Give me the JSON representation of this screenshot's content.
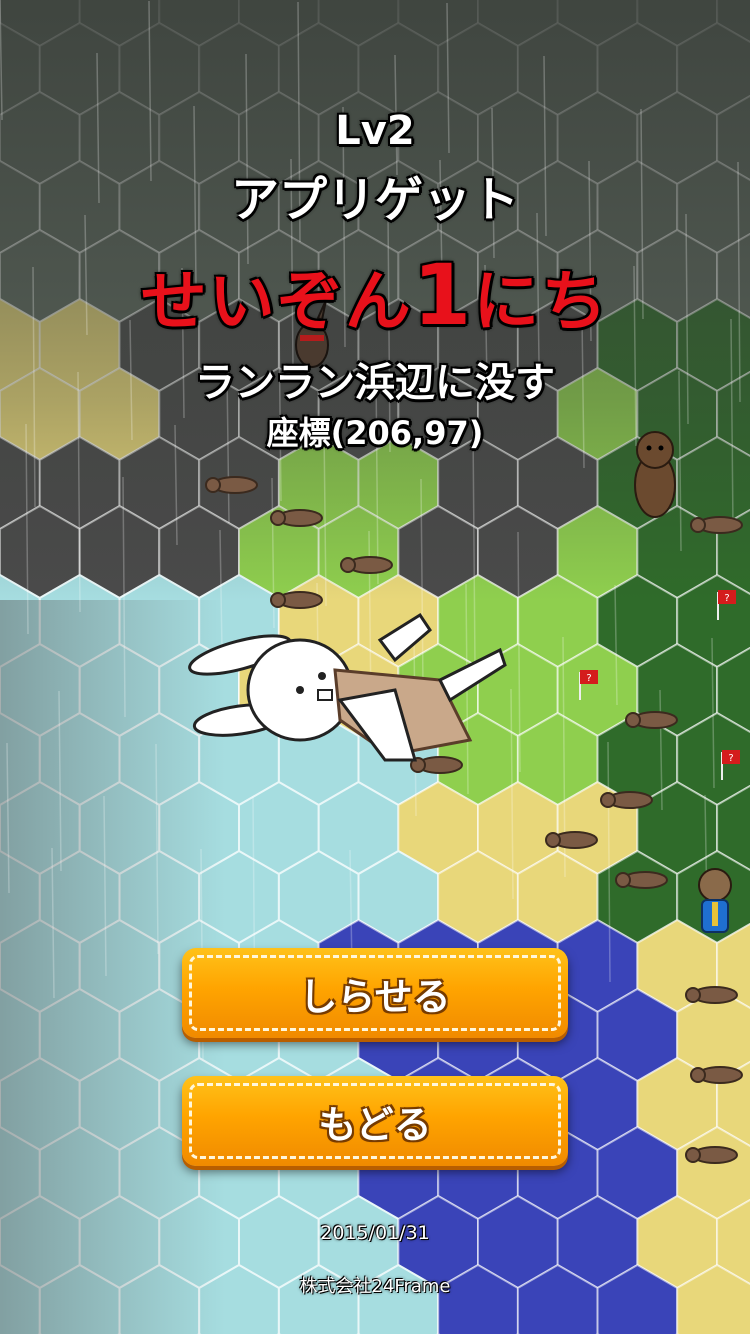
{
  "result": {
    "level": "Lv2",
    "app_name": "アプリゲット",
    "survive_prefix": "せいぞん",
    "survive_days": "1",
    "survive_suffix": "にち",
    "death_place": "ランラン浜辺に没す",
    "coordinates": "座標(206,97)"
  },
  "buttons": {
    "notify_label": "しらせる",
    "back_label": "もどる"
  },
  "footer": {
    "date": "2015/01/31",
    "company": "株式会社24Frame"
  },
  "colors": {
    "survive_text": "#e8111b",
    "button_orange": "#ffa400",
    "water": "#a6dde0",
    "deep_water": "#3a44b8",
    "sand": "#e8d77a",
    "grass": "#8fcf4e",
    "forest": "#2f6b2a",
    "rock": "#4a4a4a",
    "fog": "#5f6a60"
  },
  "characters": {
    "rabbit": "white-rabbit-lying",
    "enemies": [
      "brown-bear-standing",
      "masked-ninja-rabbit",
      "bear-in-blue-suit"
    ],
    "items": [
      "red-flag-question"
    ]
  }
}
